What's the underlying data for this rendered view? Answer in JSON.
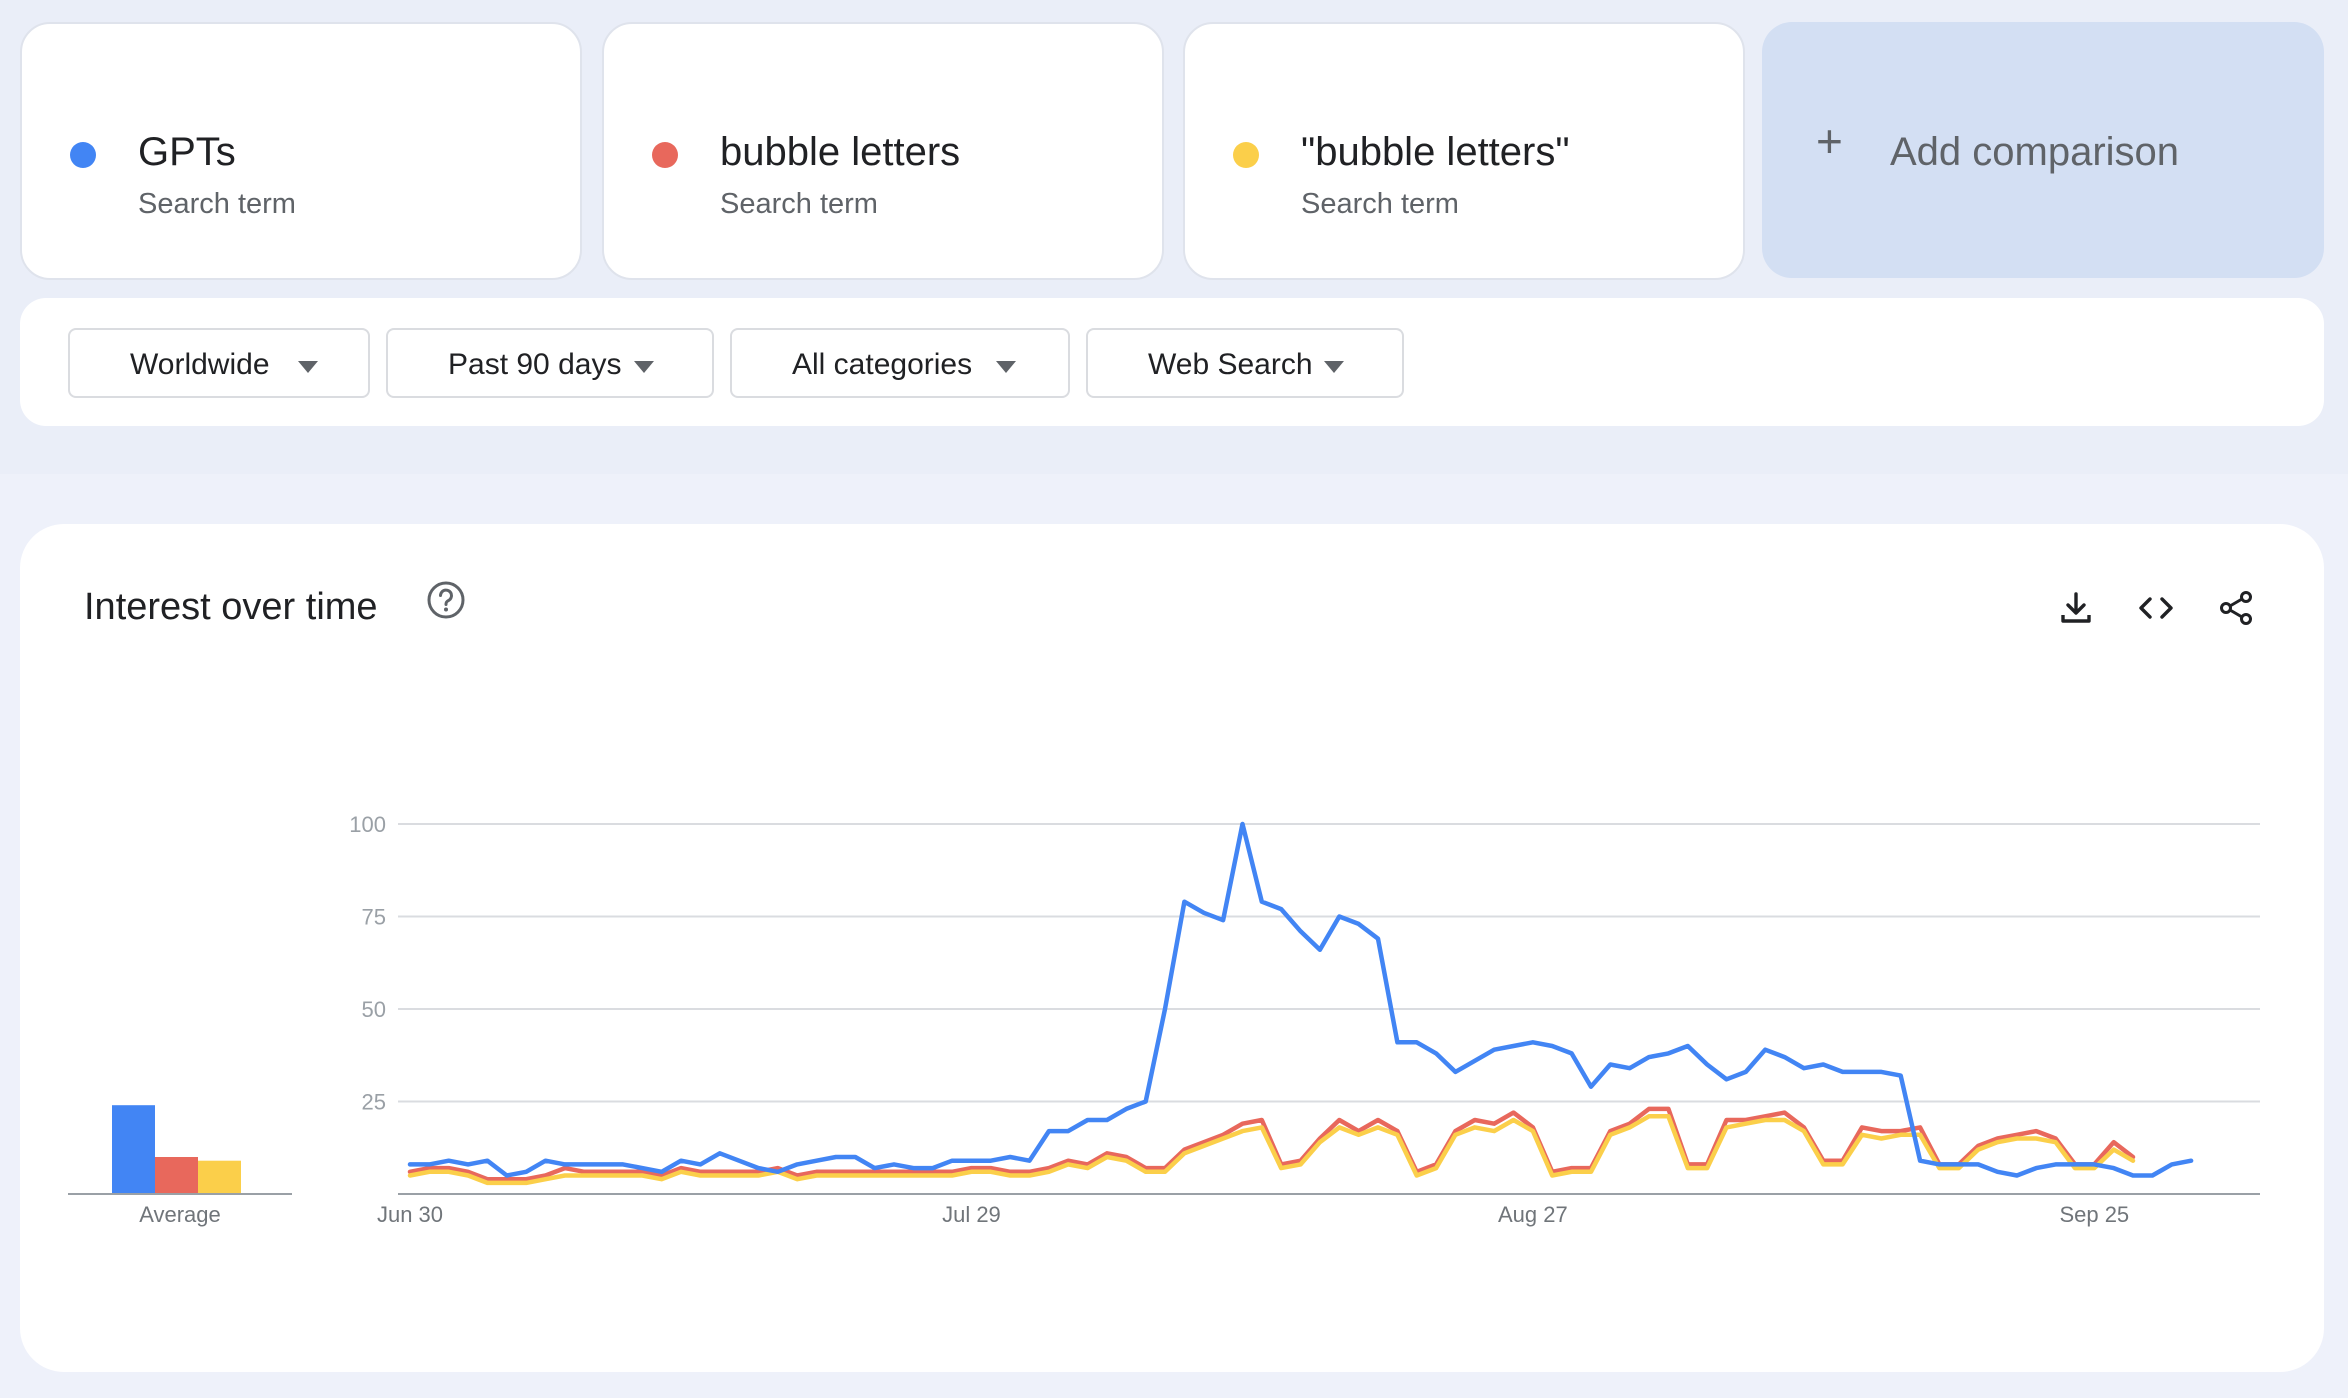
{
  "terms": [
    {
      "name": "GPTs",
      "type": "Search term",
      "color": "#4285f4"
    },
    {
      "name": "bubble letters",
      "type": "Search term",
      "color": "#e8685c"
    },
    {
      "name": "\"bubble letters\"",
      "type": "Search term",
      "color": "#fbcf4a"
    }
  ],
  "add_comparison": {
    "icon": "plus-icon",
    "label": "Add comparison"
  },
  "filters": [
    {
      "label": "Worldwide"
    },
    {
      "label": "Past 90 days"
    },
    {
      "label": "All categories"
    },
    {
      "label": "Web Search"
    }
  ],
  "panel": {
    "title": "Interest over time",
    "icons": [
      "help-icon",
      "download-icon",
      "embed-code-icon",
      "share-icon"
    ]
  },
  "chart_data": {
    "type": "line",
    "ylim": [
      0,
      100
    ],
    "yticks": [
      25,
      50,
      75,
      100
    ],
    "x_labels": [
      "Jun 30",
      "Jul 29",
      "Aug 27",
      "Sep 25"
    ],
    "x_label_indices": [
      0,
      29,
      58,
      87
    ],
    "average_label": "Average",
    "averages": [
      24,
      10,
      9
    ],
    "colors": [
      "#4285f4",
      "#e8685c",
      "#fbcf4a"
    ],
    "series": [
      {
        "name": "GPTs",
        "values": [
          8,
          8,
          9,
          8,
          9,
          5,
          6,
          9,
          8,
          8,
          8,
          8,
          7,
          6,
          9,
          8,
          11,
          9,
          7,
          6,
          8,
          9,
          10,
          10,
          7,
          8,
          7,
          7,
          9,
          9,
          9,
          10,
          9,
          17,
          17,
          20,
          20,
          23,
          25,
          50,
          79,
          76,
          74,
          100,
          79,
          77,
          71,
          66,
          75,
          73,
          69,
          41,
          41,
          38,
          33,
          36,
          39,
          40,
          41,
          40,
          38,
          29,
          35,
          34,
          37,
          38,
          40,
          35,
          31,
          33,
          39,
          37,
          34,
          35,
          33,
          33,
          33,
          32,
          9,
          8,
          8,
          8,
          6,
          5,
          7,
          8,
          8,
          8,
          7,
          5,
          5,
          8,
          9
        ]
      },
      {
        "name": "bubble letters",
        "values": [
          6,
          7,
          7,
          6,
          4,
          4,
          4,
          5,
          7,
          6,
          6,
          6,
          6,
          5,
          7,
          6,
          6,
          6,
          6,
          7,
          5,
          6,
          6,
          6,
          6,
          6,
          6,
          6,
          6,
          7,
          7,
          6,
          6,
          7,
          9,
          8,
          11,
          10,
          7,
          7,
          12,
          14,
          16,
          19,
          20,
          8,
          9,
          15,
          20,
          17,
          20,
          17,
          6,
          8,
          17,
          20,
          19,
          22,
          18,
          6,
          7,
          7,
          17,
          19,
          23,
          23,
          8,
          8,
          20,
          20,
          21,
          22,
          18,
          9,
          9,
          18,
          17,
          17,
          18,
          8,
          8,
          13,
          15,
          16,
          17,
          15,
          8,
          8,
          14,
          10
        ]
      },
      {
        "name": "\"bubble letters\"",
        "values": [
          5,
          6,
          6,
          5,
          3,
          3,
          3,
          4,
          5,
          5,
          5,
          5,
          5,
          4,
          6,
          5,
          5,
          5,
          5,
          6,
          4,
          5,
          5,
          5,
          5,
          5,
          5,
          5,
          5,
          6,
          6,
          5,
          5,
          6,
          8,
          7,
          10,
          9,
          6,
          6,
          11,
          13,
          15,
          17,
          18,
          7,
          8,
          14,
          18,
          16,
          18,
          16,
          5,
          7,
          16,
          18,
          17,
          20,
          17,
          5,
          6,
          6,
          16,
          18,
          21,
          21,
          7,
          7,
          18,
          19,
          20,
          20,
          17,
          8,
          8,
          16,
          15,
          16,
          16,
          7,
          7,
          12,
          14,
          15,
          15,
          14,
          7,
          7,
          12,
          9
        ]
      }
    ]
  }
}
